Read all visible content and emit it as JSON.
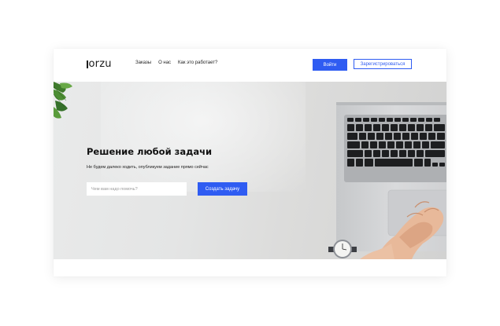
{
  "brand": {
    "logo_text": "orzu"
  },
  "nav": {
    "items": [
      {
        "label": "Заказы"
      },
      {
        "label": "О нас"
      },
      {
        "label": "Как это работает?"
      }
    ]
  },
  "auth": {
    "login_label": "Войти",
    "register_label": "Зарегистрироваться"
  },
  "hero": {
    "title": "Решение любой задачи",
    "subtitle": "Не будем далеко ходить, опубликуем задание прямо сейчас",
    "search_placeholder": "Чем вам надо помочь?",
    "search_value": "",
    "create_label": "Создать задачу"
  },
  "colors": {
    "accent": "#2f5cf2",
    "hero_background": "#e4e5e5",
    "page_background": "#ffffff"
  },
  "icons": [
    "plant-leaves",
    "laptop-keyboard",
    "clasped-hands",
    "wristwatch"
  ]
}
